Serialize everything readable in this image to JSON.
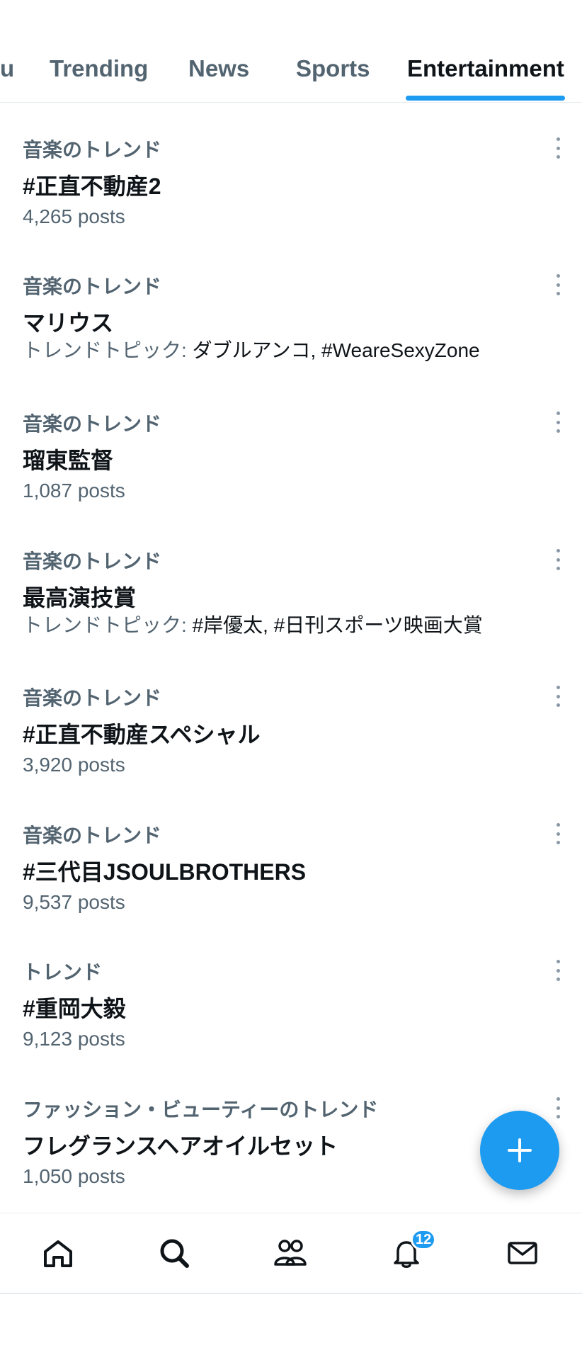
{
  "tabs": [
    "u",
    "Trending",
    "News",
    "Sports",
    "Entertainment"
  ],
  "active_tab": "Entertainment",
  "trends": [
    {
      "category": "音楽のトレンド",
      "name": "#正直不動産2",
      "meta": "4,265 posts"
    },
    {
      "category": "音楽のトレンド",
      "name": "マリウス",
      "meta_label": "トレンドトピック: ",
      "meta_topics": "ダブルアンコ, #WeareSexyZone"
    },
    {
      "category": "音楽のトレンド",
      "name": "瑠東監督",
      "meta": "1,087 posts"
    },
    {
      "category": "音楽のトレンド",
      "name": "最高演技賞",
      "meta_label": "トレンドトピック: ",
      "meta_topics": "#岸優太, #日刊スポーツ映画大賞"
    },
    {
      "category": "音楽のトレンド",
      "name": "#正直不動産スペシャル",
      "meta": "3,920 posts"
    },
    {
      "category": "音楽のトレンド",
      "name": "#三代目JSOULBROTHERS",
      "meta": "9,537 posts"
    },
    {
      "category": "トレンド",
      "name": "#重岡大毅",
      "meta": "9,123 posts"
    },
    {
      "category": "ファッション・ビューティーのトレンド",
      "name": "フレグランスヘアオイルセット",
      "meta": "1,050 posts"
    }
  ],
  "bottom_nav": {
    "items": [
      "home-icon",
      "search-icon",
      "communities-icon",
      "notifications-icon",
      "messages-icon"
    ],
    "notification_count": "12"
  },
  "colors": {
    "accent": "#1d9bf0",
    "text_primary": "#0f1419",
    "text_secondary": "#536471"
  },
  "fab_icon": "compose-plus-icon"
}
